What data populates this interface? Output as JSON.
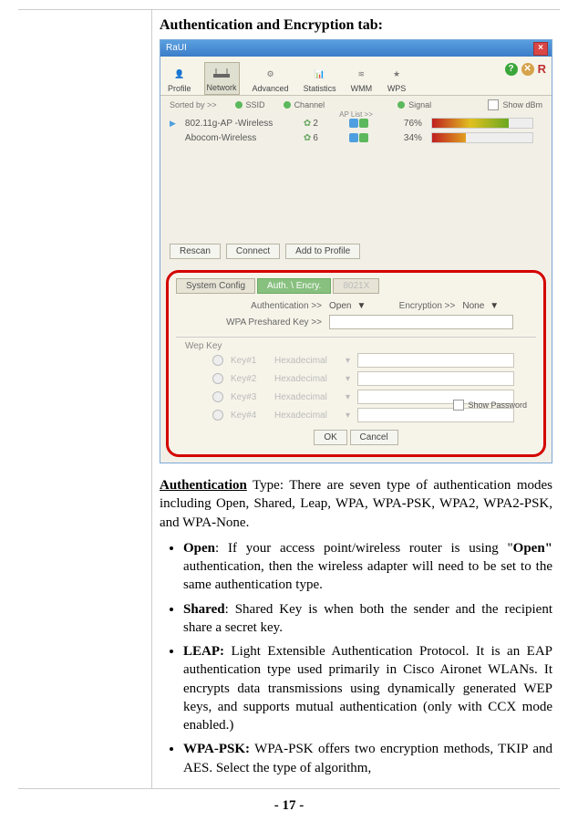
{
  "doc": {
    "section_heading": "Authentication and Encryption tab:",
    "page_footer": "- 17 -"
  },
  "shot": {
    "title": "RaUI",
    "close": "×",
    "toolbar": {
      "profile": "Profile",
      "network": "Network",
      "advanced": "Advanced",
      "statistics": "Statistics",
      "wmm": "WMM",
      "wps": "WPS",
      "help_q": "?",
      "help_r": "R"
    },
    "sorted": {
      "label": "Sorted by >>",
      "ssid": "SSID",
      "channel": "Channel",
      "signal": "Signal",
      "show_dbm": "Show dBm",
      "aplist": "AP List >>"
    },
    "aplist": [
      {
        "name": "802.11g-AP -Wireless",
        "channel": "2",
        "signal_pct": "76%",
        "fill": 76,
        "active": true
      },
      {
        "name": "Abocom-Wireless",
        "channel": "6",
        "signal_pct": "34%",
        "fill": 34,
        "active": false
      }
    ],
    "buttons": {
      "rescan": "Rescan",
      "connect": "Connect",
      "add": "Add to Profile"
    },
    "tabs": {
      "system_config": "System Config",
      "auth_encry": "Auth. \\ Encry.",
      "dot1x": "8021X"
    },
    "auth": {
      "auth_label": "Authentication >>",
      "auth_value": "Open",
      "enc_label": "Encryption >>",
      "enc_value": "None",
      "wpa_label": "WPA Preshared Key >>"
    },
    "wep": {
      "group_label": "Wep Key",
      "keys": [
        {
          "label": "Key#1",
          "type": "Hexadecimal"
        },
        {
          "label": "Key#2",
          "type": "Hexadecimal"
        },
        {
          "label": "Key#3",
          "type": "Hexadecimal"
        },
        {
          "label": "Key#4",
          "type": "Hexadecimal"
        }
      ],
      "show_password": "Show Password"
    },
    "ok": "OK",
    "cancel": "Cancel"
  },
  "body": {
    "auth_para_lead": "Authentication",
    "auth_para_rest": " Type: There are seven type of authentication modes including Open, Shared, Leap, WPA, WPA-PSK, WPA2, WPA2-PSK, and WPA-None.",
    "open_head": "Open",
    "open_text_a": ": If your access point/wireless router is using \"",
    "open_bold": "Open\"",
    "open_text_b": " authentication, then the wireless adapter will need to be set to the same authentication type.",
    "shared_head": "Shared",
    "shared_text": ": Shared Key is when both the sender and the recipient share a secret key.",
    "leap_head": "LEAP:",
    "leap_text": " Light Extensible Authentication Protocol. It is an EAP authentication type used primarily in Cisco Aironet WLANs. It encrypts data transmissions using dynamically generated WEP keys, and supports mutual authentication (only with CCX mode enabled.)",
    "wpapsk_head": "WPA-PSK:",
    "wpapsk_text": " WPA-PSK offers two encryption methods, TKIP and AES. Select the type of algorithm,"
  }
}
